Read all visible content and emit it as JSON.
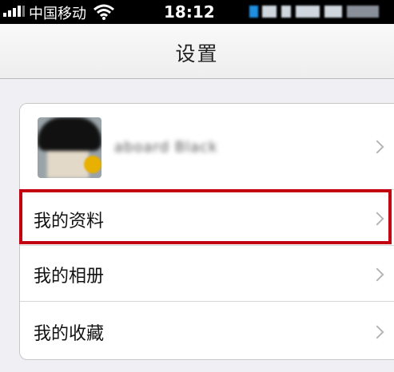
{
  "status_bar": {
    "carrier": "中国移动",
    "time": "18:12",
    "signal_icon": "signal-bars-icon",
    "wifi_icon": "wifi-icon"
  },
  "nav": {
    "title": "设置"
  },
  "profile": {
    "name": "aboard Black",
    "avatar_icon": "avatar"
  },
  "menu": {
    "items": [
      {
        "label": "我的资料",
        "highlighted": true
      },
      {
        "label": "我的相册",
        "highlighted": false
      },
      {
        "label": "我的收藏",
        "highlighted": false
      }
    ]
  },
  "colors": {
    "highlight_border": "#c2000f",
    "background": "#efeff4",
    "chevron": "#b5b5b5"
  }
}
